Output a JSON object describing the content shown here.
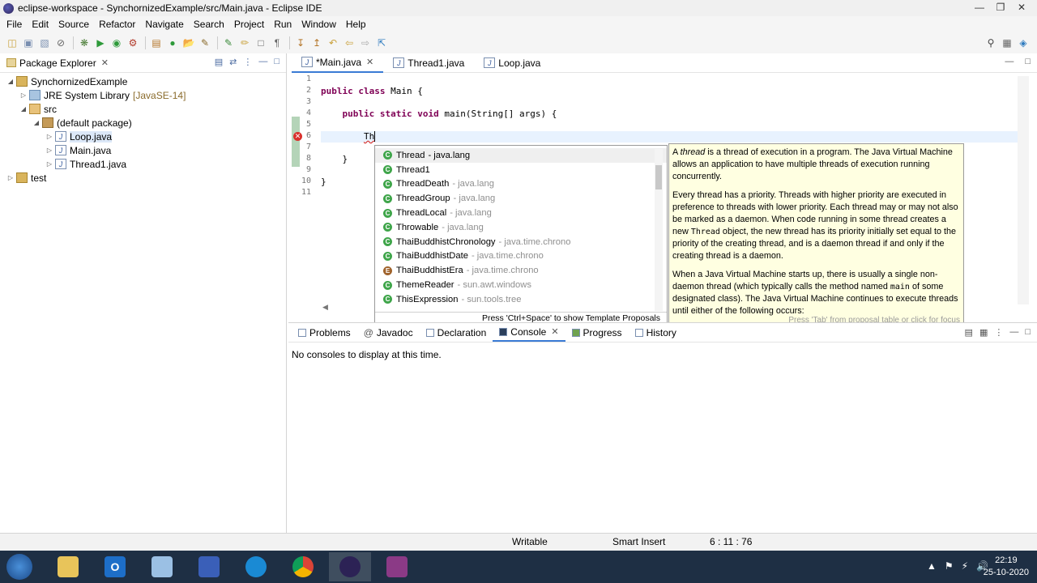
{
  "window": {
    "title": "eclipse-workspace - SynchornizedExample/src/Main.java - Eclipse IDE"
  },
  "menu": [
    "File",
    "Edit",
    "Source",
    "Refactor",
    "Navigate",
    "Search",
    "Project",
    "Run",
    "Window",
    "Help"
  ],
  "package_explorer": {
    "title": "Package Explorer",
    "project": "SynchornizedExample",
    "jre": "JRE System Library",
    "jre_version": "[JavaSE-14]",
    "src": "src",
    "default_package": "(default package)",
    "files": [
      "Loop.java",
      "Main.java",
      "Thread1.java"
    ],
    "test_project": "test"
  },
  "editor": {
    "tabs": [
      "*Main.java",
      "Thread1.java",
      "Loop.java"
    ],
    "line_numbers": [
      "1",
      "2",
      "3",
      "4",
      "5",
      "6",
      "7",
      "8",
      "9",
      "10",
      "11"
    ],
    "lines": {
      "l2_kw": "public class",
      "l2_rest": " Main {",
      "l4_kw": "public static void",
      "l4_rest": " main(String[] args) {",
      "l6_text": "Th",
      "l8_text": "}",
      "l10_text": "}"
    }
  },
  "content_assist": {
    "proposals": [
      {
        "name": "Thread",
        "pkg": "- java.lang",
        "kind": "class"
      },
      {
        "name": "Thread1",
        "pkg": "",
        "kind": "class"
      },
      {
        "name": "ThreadDeath",
        "pkg": "- java.lang",
        "kind": "class"
      },
      {
        "name": "ThreadGroup",
        "pkg": "- java.lang",
        "kind": "class"
      },
      {
        "name": "ThreadLocal",
        "pkg": "- java.lang",
        "kind": "class"
      },
      {
        "name": "Throwable",
        "pkg": "- java.lang",
        "kind": "class"
      },
      {
        "name": "ThaiBuddhistChronology",
        "pkg": "- java.time.chrono",
        "kind": "class"
      },
      {
        "name": "ThaiBuddhistDate",
        "pkg": "- java.time.chrono",
        "kind": "class"
      },
      {
        "name": "ThaiBuddhistEra",
        "pkg": "- java.time.chrono",
        "kind": "enum"
      },
      {
        "name": "ThemeReader",
        "pkg": "- sun.awt.windows",
        "kind": "class"
      },
      {
        "name": "ThisExpression",
        "pkg": "- sun.tools.tree",
        "kind": "class"
      }
    ],
    "footer": "Press 'Ctrl+Space' to show Template Proposals"
  },
  "javadoc": {
    "p1_a": "A ",
    "p1_em": "thread",
    "p1_b": " is a thread of execution in a program. The Java Virtual Machine allows an application to have multiple threads of execution running concurrently.",
    "p2_a": "Every thread has a priority. Threads with higher priority are executed in preference to threads with lower priority. Each thread may or may not also be marked as a daemon. When code running in some thread creates a new ",
    "p2_code": "Thread",
    "p2_b": " object, the new thread has its priority initially set equal to the priority of the creating thread, and is a daemon thread if and only if the creating thread is a daemon.",
    "p3_a": "When a Java Virtual Machine starts up, there is usually a single non-daemon thread (which typically calls the method named ",
    "p3_code": "main",
    "p3_b": " of some designated class). The Java Virtual Machine continues to execute threads until either of the following occurs:",
    "footer": "Press 'Tab' from proposal table or click for focus"
  },
  "bottom_panel": {
    "tabs": [
      "Problems",
      "Javadoc",
      "Declaration",
      "Console",
      "Progress",
      "History"
    ],
    "active_tab": "Console",
    "message": "No consoles to display at this time."
  },
  "status_bar": {
    "mode": "Writable",
    "insert": "Smart Insert",
    "position": "6 : 11 : 76"
  },
  "taskbar": {
    "time": "22:19",
    "date": "25-10-2020"
  }
}
